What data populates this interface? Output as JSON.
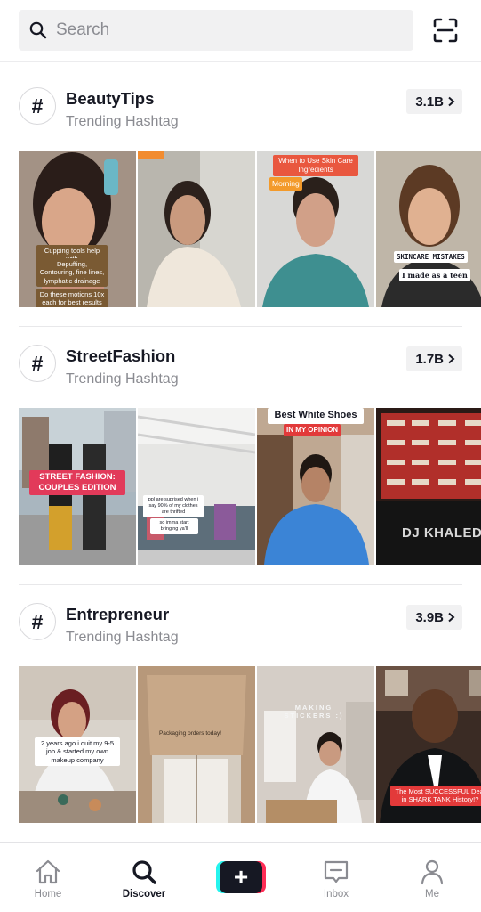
{
  "search": {
    "placeholder": "Search"
  },
  "sections": [
    {
      "hashtag": "BeautyTips",
      "subtitle": "Trending Hashtag",
      "count": "3.1B",
      "captions": [
        [
          "Cupping tools help with",
          "Depuffing, Contouring, fine lines, lymphatic drainage",
          "Do these motions 10x each for best results"
        ],
        [],
        [
          "When to Use Skin Care Ingredients",
          "Morning"
        ],
        [
          "SKINCARE MISTAKES",
          "I made as a teen"
        ]
      ]
    },
    {
      "hashtag": "StreetFashion",
      "subtitle": "Trending Hashtag",
      "count": "1.7B",
      "captions": [
        [
          "STREET FASHION: COUPLES EDITION"
        ],
        [
          "ppl are suprised when i say 90% of my clothes are thrifted",
          "so imma start bringing ya'll"
        ],
        [
          "Best White Shoes",
          "IN MY OPINION"
        ],
        [
          "DJ KHALED"
        ]
      ]
    },
    {
      "hashtag": "Entrepreneur",
      "subtitle": "Trending Hashtag",
      "count": "3.9B",
      "captions": [
        [
          "2 years ago i quit my 9-5 job & started my own makeup company"
        ],
        [
          "Packaging orders today!"
        ],
        [
          "MAKING STICKERS :)"
        ],
        [
          "The Most SUCCESSFUL Deal in SHARK TANK History!?"
        ]
      ]
    }
  ],
  "nav": {
    "home": "Home",
    "discover": "Discover",
    "create_symbol": "+",
    "inbox": "Inbox",
    "me": "Me"
  },
  "colors": {
    "accent_cyan": "#25f4ee",
    "accent_red": "#fe2c55",
    "text_primary": "#161823",
    "text_secondary": "#8a8b91"
  }
}
